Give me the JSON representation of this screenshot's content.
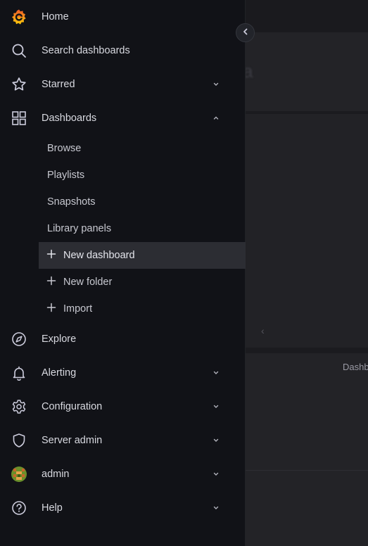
{
  "background": {
    "ghost_text": "a",
    "panel_text": "Dashb"
  },
  "nav": {
    "home": "Home",
    "search": "Search dashboards",
    "starred": "Starred",
    "dashboards": "Dashboards",
    "dashboards_sub": {
      "browse": "Browse",
      "playlists": "Playlists",
      "snapshots": "Snapshots",
      "library_panels": "Library panels",
      "new_dashboard": "New dashboard",
      "new_folder": "New folder",
      "import": "Import"
    },
    "explore": "Explore",
    "alerting": "Alerting",
    "configuration": "Configuration",
    "server_admin": "Server admin",
    "admin": "admin",
    "help": "Help"
  },
  "icons": {
    "logo": "grafana-logo-icon",
    "collapse": "chevron-left-icon"
  },
  "colors": {
    "sidebar_bg": "#111217",
    "active_bg": "#2c2d33",
    "logo_orange": "#f05a28",
    "logo_yellow": "#fbca0a"
  }
}
